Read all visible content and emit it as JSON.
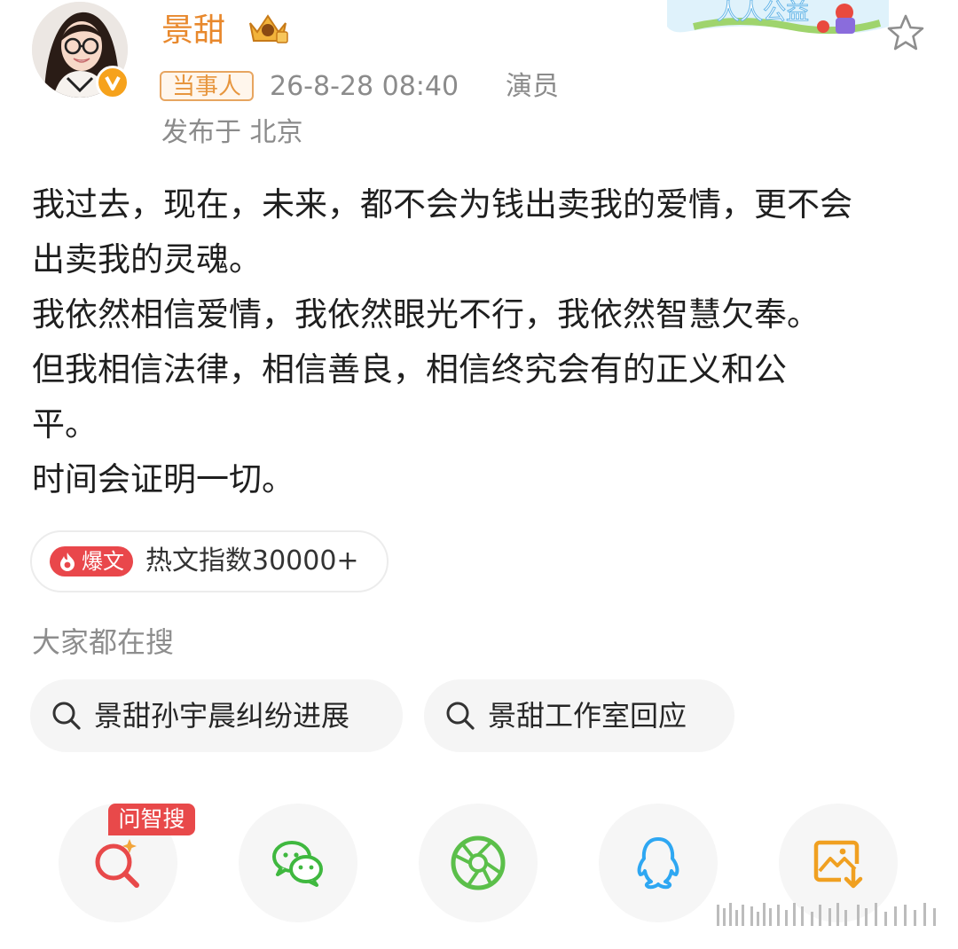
{
  "header": {
    "username": "景甜",
    "tag": "当事人",
    "datetime": "26-8-28 08:40",
    "role": "演员",
    "location": "发布于 北京",
    "icons": [
      "avatar",
      "verified-v-icon",
      "crown-badge-icon",
      "public-welfare-banner",
      "star-icon"
    ],
    "colors": {
      "name": "#e8882c",
      "tag": "#e7963e",
      "meta": "#8b8b8b"
    }
  },
  "post": {
    "lines": [
      "我过去，现在，未来，都不会为钱出卖我的爱情，更不会",
      "出卖我的灵魂。",
      "我依然相信爱情，我依然眼光不行，我依然智慧欠奉。",
      "但我相信法律，相信善良，相信终究会有的正义和公",
      "平。",
      "时间会证明一切。"
    ]
  },
  "hot": {
    "badge": "爆文",
    "text": "热文指数30000+",
    "color": "#e9474b"
  },
  "search": {
    "title": "大家都在搜",
    "items": [
      {
        "label": "景甜孙宇晨纠纷进展",
        "icon": "search-icon"
      },
      {
        "label": "景甜工作室回应",
        "icon": "search-icon"
      }
    ]
  },
  "share": {
    "ask_badge": "问智搜",
    "items": [
      {
        "name": "ask-search",
        "icon": "ai-search-icon",
        "color": "#e8494a"
      },
      {
        "name": "wechat",
        "icon": "wechat-icon",
        "color": "#3fb83f"
      },
      {
        "name": "moments",
        "icon": "moments-icon",
        "color": "#5bbf4a"
      },
      {
        "name": "qq",
        "icon": "qq-icon",
        "color": "#2ea7f2"
      },
      {
        "name": "save-image",
        "icon": "save-image-icon",
        "color": "#f0a021"
      }
    ]
  }
}
